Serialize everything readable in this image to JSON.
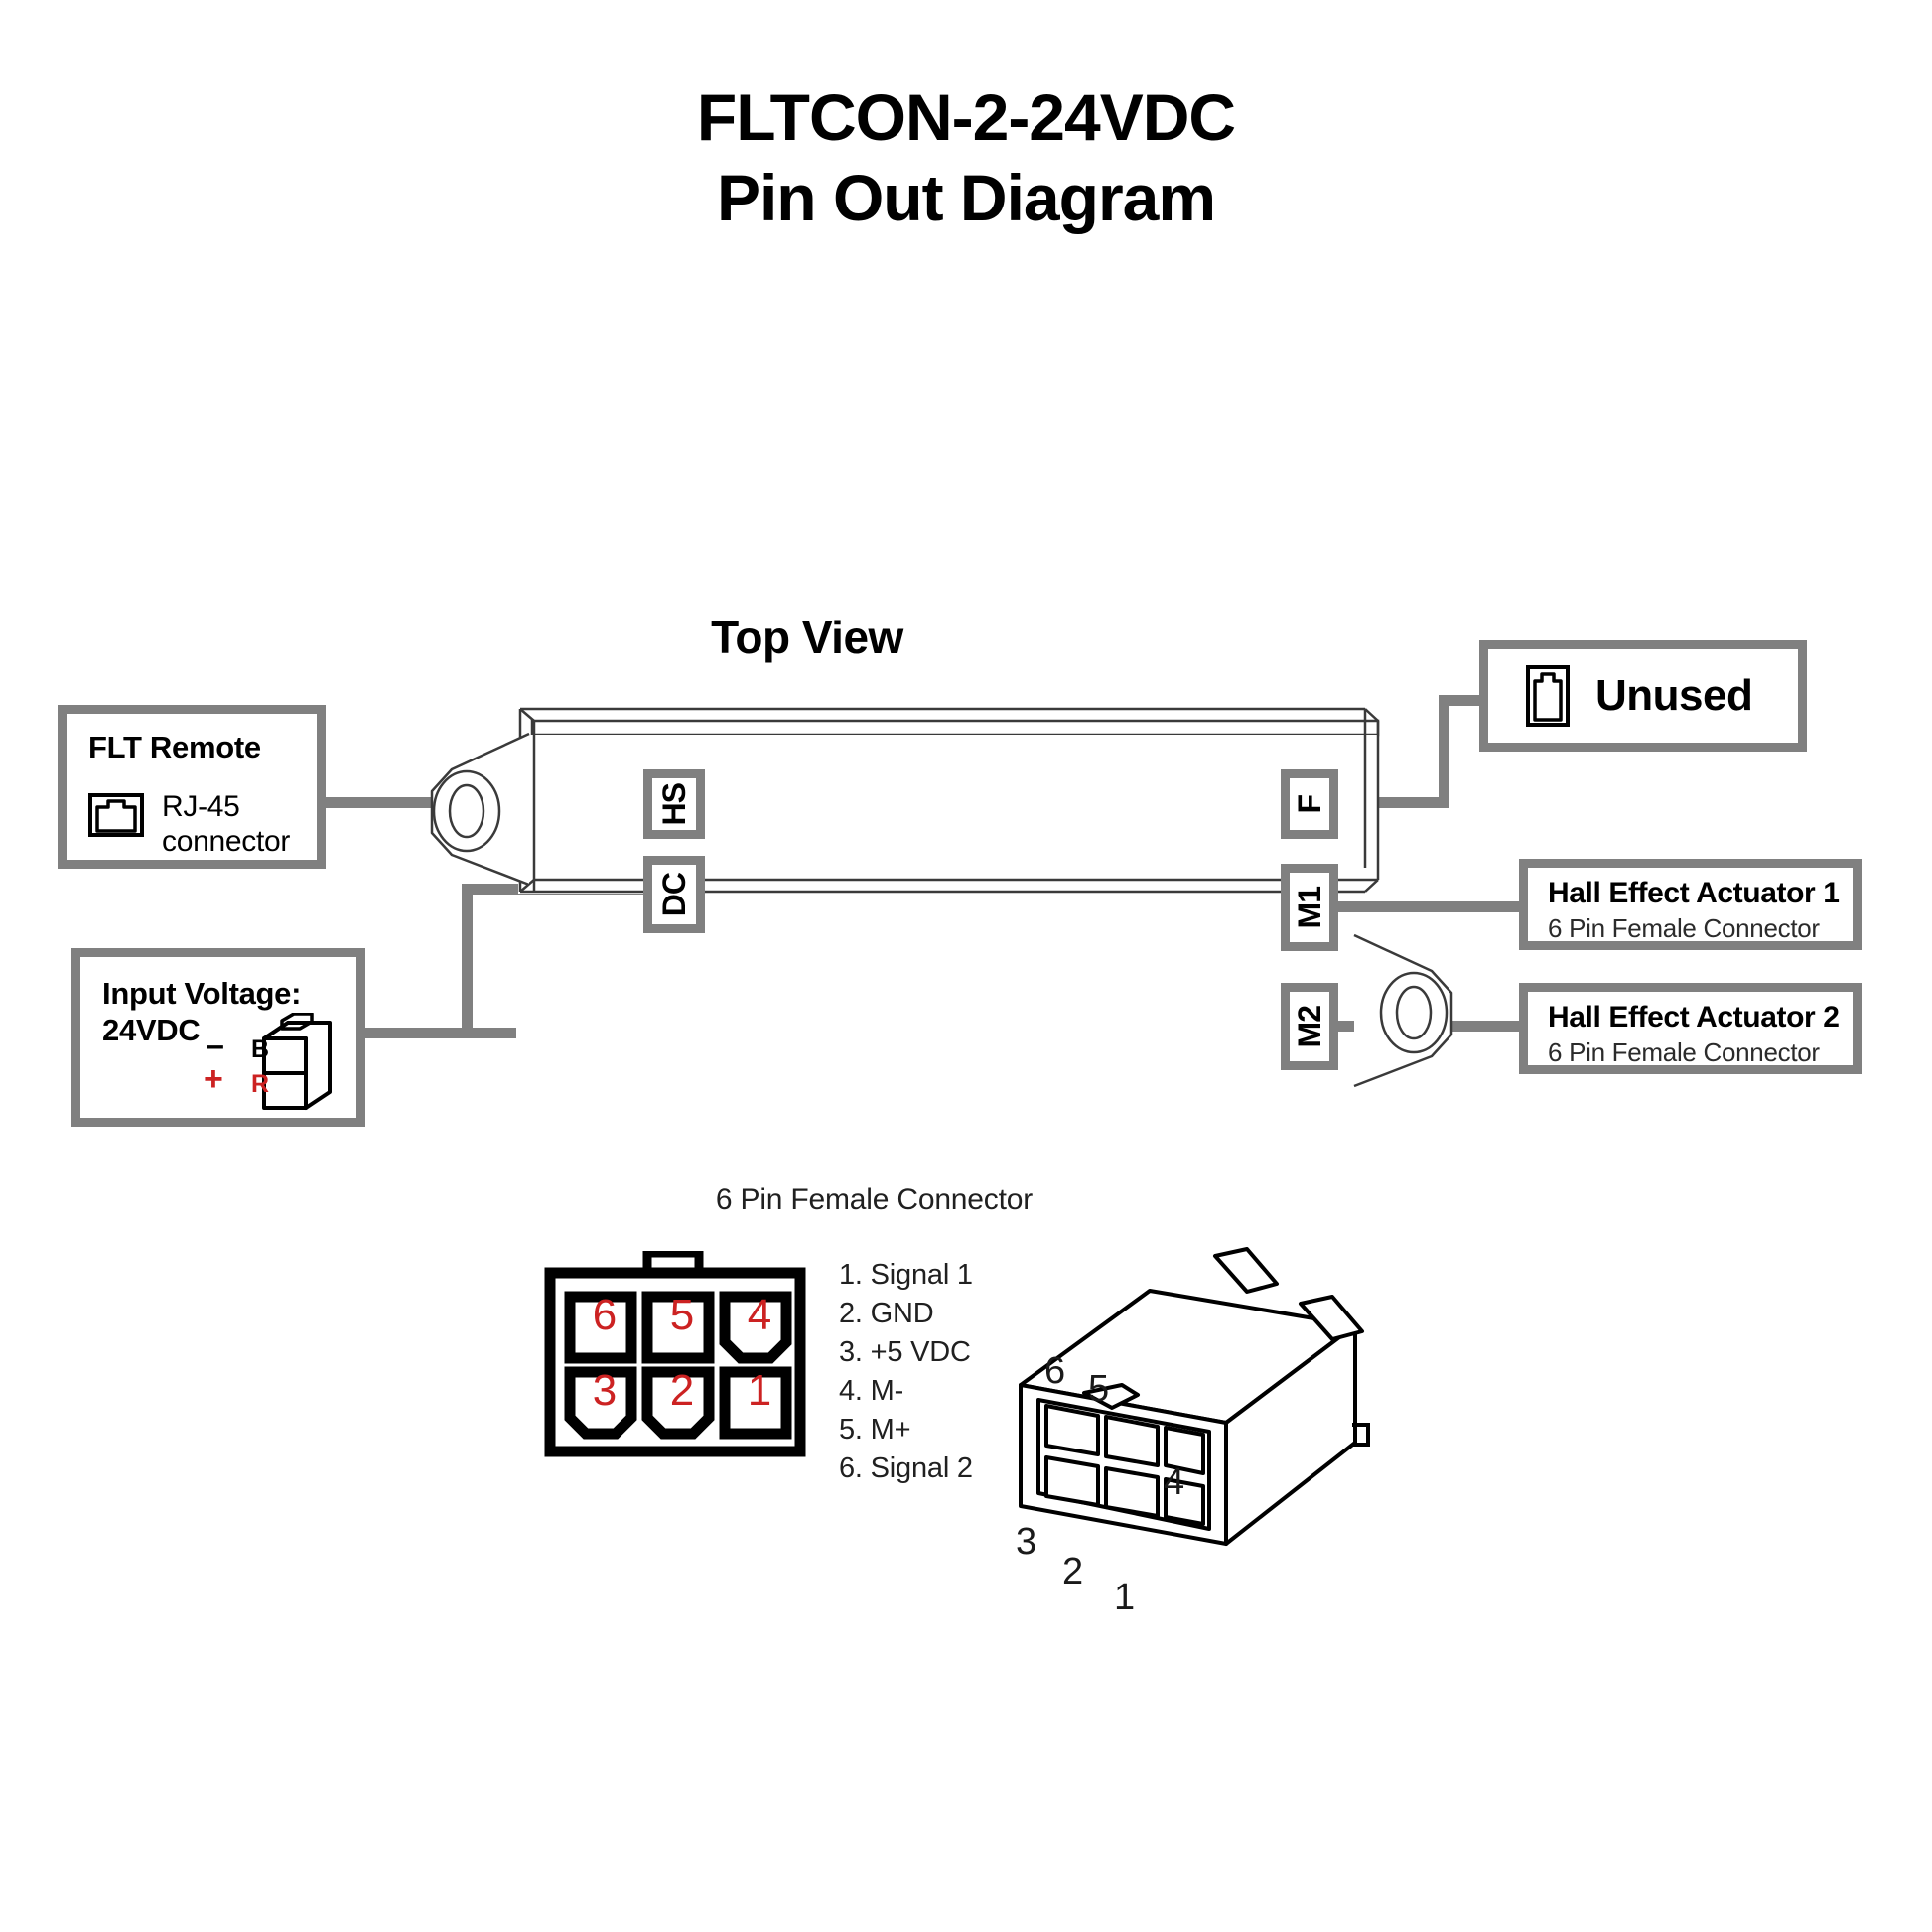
{
  "title": {
    "line1": "FLTCON-2-24VDC",
    "line2": "Pin Out Diagram"
  },
  "device": {
    "view_label": "Top View"
  },
  "callouts": {
    "flt_remote": {
      "header": "FLT Remote",
      "connector_line1": "RJ-45",
      "connector_line2": "connector",
      "icon": "rj45-jack-icon"
    },
    "input_voltage": {
      "line1": "Input Voltage:",
      "line2": "24VDC",
      "negative_symbol": "–",
      "positive_symbol": "+",
      "black_wire_label": "B",
      "red_wire_label": "R",
      "icon": "two-pin-power-connector-icon"
    },
    "unused": {
      "label": "Unused",
      "icon": "rj45-jack-vertical-icon"
    },
    "hall_actuator_1": {
      "header": "Hall Effect Actuator 1",
      "sub": "6 Pin Female Connector"
    },
    "hall_actuator_2": {
      "header": "Hall Effect Actuator 2",
      "sub": "6 Pin Female Connector"
    }
  },
  "pins": {
    "hs": "HS",
    "dc": "DC",
    "f": "F",
    "m1": "M1",
    "m2": "M2"
  },
  "pinout": {
    "caption": "6 Pin Female Connector",
    "face_numbers_top": [
      "6",
      "5",
      "4"
    ],
    "face_numbers_bottom": [
      "3",
      "2",
      "1"
    ],
    "assignments": [
      "1. Signal 1",
      "2. GND",
      "3. +5 VDC",
      "4. M-",
      "5. M+",
      "6. Signal 2"
    ],
    "iso_labels": {
      "p6": "6",
      "p5": "5",
      "p4": "4",
      "p3": "3",
      "p2": "2",
      "p1": "1"
    }
  },
  "colors": {
    "wire_gray": "#808080",
    "pin_number_red": "#cc2222",
    "outline_black": "#000000",
    "device_outline": "#3a3a3a"
  }
}
